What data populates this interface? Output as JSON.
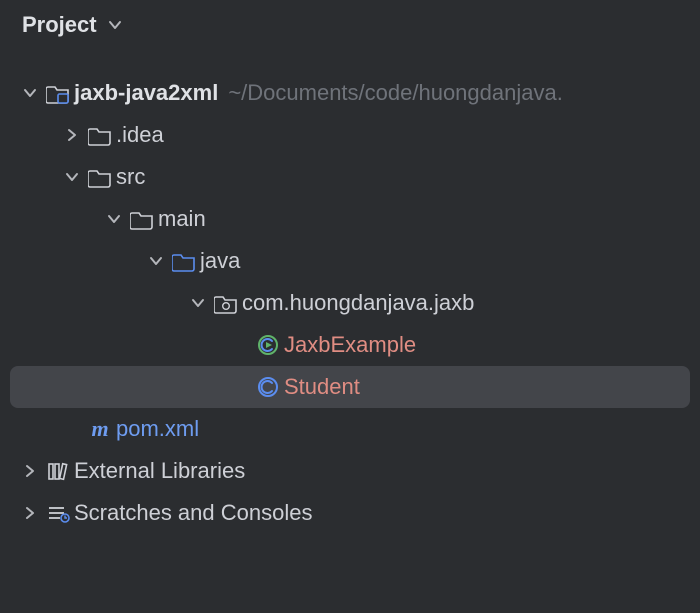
{
  "panel": {
    "title": "Project"
  },
  "tree": {
    "root": {
      "label": "jaxb-java2xml",
      "path": "~/Documents/code/huongdanjava."
    },
    "items": {
      "idea": {
        "label": ".idea"
      },
      "src": {
        "label": "src"
      },
      "main": {
        "label": "main"
      },
      "java": {
        "label": "java"
      },
      "pkg": {
        "label": "com.huongdanjava.jaxb"
      },
      "jaxbex": {
        "label": "JaxbExample"
      },
      "student": {
        "label": "Student"
      },
      "pom": {
        "prefix": "m",
        "label": "pom.xml"
      },
      "ext": {
        "label": "External Libraries"
      },
      "scratch": {
        "label": "Scratches and Consoles"
      }
    }
  }
}
